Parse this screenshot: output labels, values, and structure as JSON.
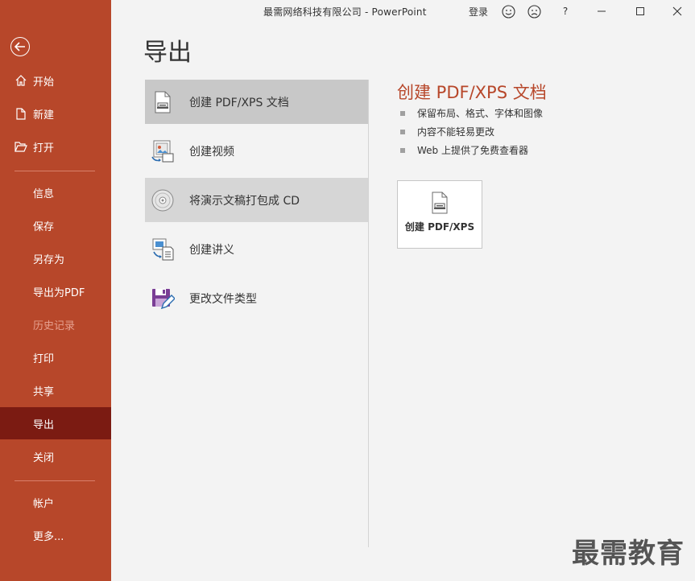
{
  "titlebar": {
    "title": "最需网络科技有限公司  -  PowerPoint",
    "signin": "登录",
    "help": "?",
    "buttons": [
      "smiley-icon",
      "frown-icon",
      "help-icon",
      "minimize-icon",
      "maximize-icon",
      "close-icon"
    ]
  },
  "sidebar": {
    "colors": {
      "background": "#b7472a",
      "active": "#7b1b12"
    },
    "top_items": [
      {
        "label": "开始",
        "icon": "home-icon"
      },
      {
        "label": "新建",
        "icon": "new-document-icon"
      },
      {
        "label": "打开",
        "icon": "open-folder-icon"
      }
    ],
    "items": [
      {
        "label": "信息",
        "state": "normal"
      },
      {
        "label": "保存",
        "state": "normal"
      },
      {
        "label": "另存为",
        "state": "normal"
      },
      {
        "label": "导出为PDF",
        "state": "normal"
      },
      {
        "label": "历史记录",
        "state": "disabled"
      },
      {
        "label": "打印",
        "state": "normal"
      },
      {
        "label": "共享",
        "state": "normal"
      },
      {
        "label": "导出",
        "state": "active"
      },
      {
        "label": "关闭",
        "state": "normal"
      }
    ],
    "bottom_items": [
      {
        "label": "帐户"
      },
      {
        "label": "更多..."
      }
    ]
  },
  "page": {
    "title": "导出",
    "options": [
      {
        "label": "创建 PDF/XPS 文档",
        "icon": "pdf-document-icon",
        "state": "selected"
      },
      {
        "label": "创建视频",
        "icon": "video-icon",
        "state": "normal"
      },
      {
        "label": "将演示文稿打包成 CD",
        "icon": "cd-icon",
        "state": "hover"
      },
      {
        "label": "创建讲义",
        "icon": "handout-icon",
        "state": "normal"
      },
      {
        "label": "更改文件类型",
        "icon": "change-file-type-icon",
        "state": "normal"
      }
    ]
  },
  "detail": {
    "title": "创建 PDF/XPS 文档",
    "accent": "#b7472a",
    "bullets": [
      "保留布局、格式、字体和图像",
      "内容不能轻易更改",
      "Web 上提供了免费查看器"
    ],
    "button_label": "创建 PDF/XPS"
  },
  "watermark": "最需教育"
}
